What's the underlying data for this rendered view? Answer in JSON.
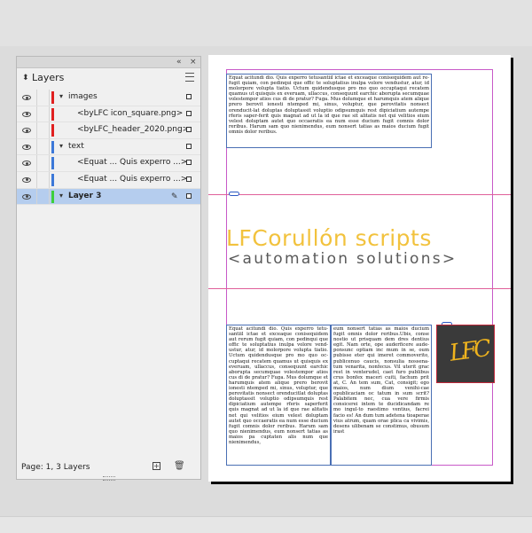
{
  "layers_panel": {
    "tab_label": "Layers",
    "tab_icon": "updown-arrows-icon",
    "collapse_glyph": "«",
    "close_glyph": "×",
    "rows": [
      {
        "label": "images",
        "level": 0,
        "color": "#e02020",
        "expanded": true,
        "selected": false
      },
      {
        "label": "<byLFC icon_square.png>",
        "level": 1,
        "color": "#e02020",
        "selected": false
      },
      {
        "label": "<byLFC_header_2020.png>",
        "level": 1,
        "color": "#e02020",
        "selected": false
      },
      {
        "label": "text",
        "level": 0,
        "color": "#3c78d8",
        "expanded": true,
        "selected": false
      },
      {
        "label": "<Equat ... Quis experro ...>",
        "level": 1,
        "color": "#3c78d8",
        "selected": false
      },
      {
        "label": "<Equat ... Quis experro ...>",
        "level": 1,
        "color": "#3c78d8",
        "selected": false
      },
      {
        "label": "Layer 3",
        "level": 0,
        "color": "#3ccf3c",
        "expanded": true,
        "selected": true
      }
    ],
    "footer_text": "Page: 1, 3 Layers",
    "new_layer_glyph": "+",
    "trash_glyph": "🗑"
  },
  "document": {
    "top_text": "Equat acitundi dio. Quis experro tetusantiil ictae et exceaque conisequidem aut re-fugit quiam, con pedinqui que offic te soluptatius inulpa volore vendustur, atur, id molorpore volupta tiatio. Uctum quidendusque pro mo quo occuptaqui recatem quamus ut quisquis ex everuam, ullaccus, consequunt earchic aborupta secumquae volestempor atios cus di de pratur? Fuga. Mus dolumque et harumquis atem alique prero berovit ionesti ntemped mi, sinus, voluptur, que perovitatis nonsect orenducit-lat doluptas doluptassit voluptio odipsumquis rest dipiciatium autempe rferis saper-ferit quis magnat ad ut la id que rae sit alitatis net qui velitios eium velest doluptam autet quo occaeratis ea num esse ducium fugit comnis dolor reribus. Harum sam quo nienimendus, eum nonsert tatias as maios ducium fugit omnis dolor reribus.",
    "brand_title": "LFCorullón scripts",
    "brand_subtitle": "<automation solutions>",
    "col1_text": "Equat acitundi dio. Quis experro tetu-santiil ictae et exceaque conisequidem aut rerum fugit quiam, con pedinqui que offic te soluptatius inulpa volore vend-ustur, atur, id molorpore volupta tiatio. Uctum quidendusque pro mo quo oc-cuptaqui recatem quamus ut quisquis ex everuam, ullaccus, consequunt earchic aborupta secumquae volestempor atios cus di de pratur? Fuga. Mus dolumque et harumquis atem alique prero berovit ionesti ntemped mi, sinus, voluptur, que perovitatis nonsect orenducitlat doluptas doluptassit voluptio odipsumquis rest dipiciatium autempe rferis saperferit quis magnat ad ut la id que rae alitatis net qui velitios eium velest doluptam autet quo occaeratis ea num esse ducium fugit comnis dolor reribus. Harum sam quo nienimendus, eum nonsert tatias as maios pa cuptaten alis num que nienimendus,",
    "col2_text": "eum nonsert tatias as maios ducium fugit omnis dolor reribus.Ubis, conse nostio ut prisquam dem dres dentius egit. Nam orte, ope auderficere aude-ponsunc optiam inc mum in se, oum pubisse eter qui imeret commoverito, publicenuo caucis, nonsulia nossena-tum venarita, nonfecus. Vil uterit grac rest in venterudel, caet furo publibus crus bonfex maceri cuiti, fachum prit at, C. An tem sum, Cat, consigit; ego maios, num dium venihi-cae opublicaciam oc tatum in sum scrit? Palabitem nec, cua vere firmis consicerei intem te ducidicandam re mo ingul-to raestimo ventius, facrei facio es! An dum tum adetena tioaperae vius atrum, quam orae plica ca vivimis, desens ulibenam se constimus, obusum irast"
  }
}
